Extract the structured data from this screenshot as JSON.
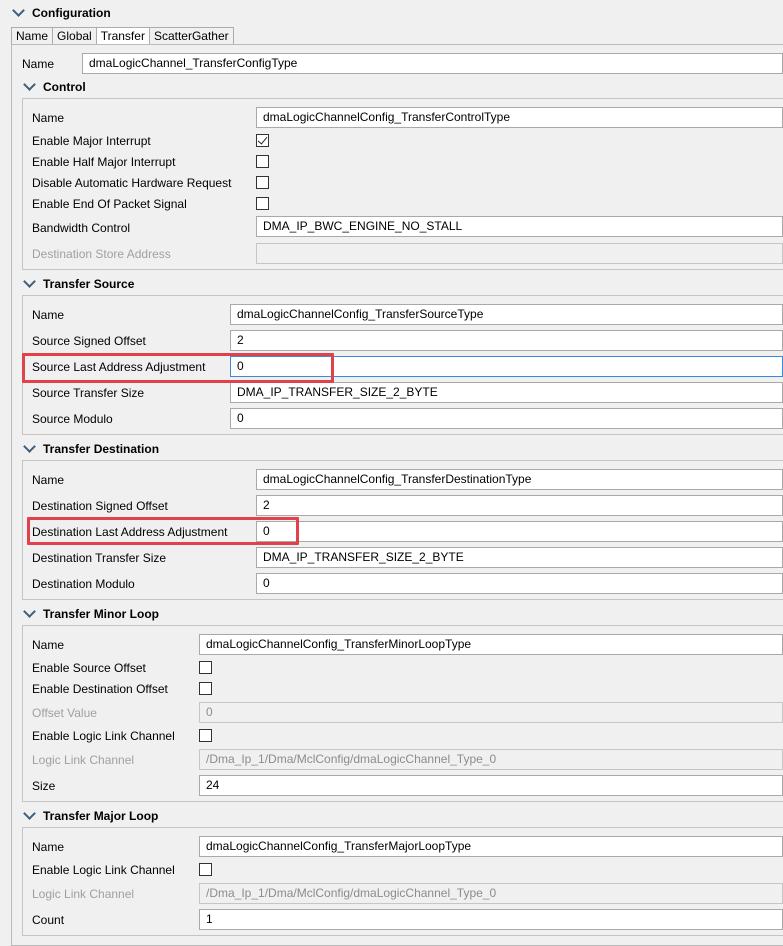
{
  "header": {
    "title": "Configuration"
  },
  "tabs": [
    "Name",
    "Global",
    "Transfer",
    "ScatterGather"
  ],
  "main": {
    "name_label": "Name",
    "name_value": "dmaLogicChannel_TransferConfigType"
  },
  "control": {
    "title": "Control",
    "name_label": "Name",
    "name_value": "dmaLogicChannelConfig_TransferControlType",
    "major_interrupt_label": "Enable Major Interrupt",
    "major_interrupt_checked": true,
    "half_major_interrupt_label": "Enable Half Major Interrupt",
    "half_major_interrupt_checked": false,
    "disable_hw_request_label": "Disable Automatic Hardware Request",
    "disable_hw_request_checked": false,
    "end_of_packet_label": "Enable End Of Packet Signal",
    "end_of_packet_checked": false,
    "bandwidth_label": "Bandwidth Control",
    "bandwidth_value": "DMA_IP_BWC_ENGINE_NO_STALL",
    "dest_store_label": "Destination Store Address",
    "dest_store_value": ""
  },
  "source": {
    "title": "Transfer Source",
    "name_label": "Name",
    "name_value": "dmaLogicChannelConfig_TransferSourceType",
    "signed_offset_label": "Source Signed Offset",
    "signed_offset_value": "2",
    "last_addr_label": "Source Last Address Adjustment",
    "last_addr_value": "0",
    "transfer_size_label": "Source Transfer Size",
    "transfer_size_value": "DMA_IP_TRANSFER_SIZE_2_BYTE",
    "modulo_label": "Source Modulo",
    "modulo_value": "0"
  },
  "destination": {
    "title": "Transfer Destination",
    "name_label": "Name",
    "name_value": "dmaLogicChannelConfig_TransferDestinationType",
    "signed_offset_label": "Destination Signed Offset",
    "signed_offset_value": "2",
    "last_addr_label": "Destination Last Address Adjustment",
    "last_addr_value": "0",
    "transfer_size_label": "Destination Transfer Size",
    "transfer_size_value": "DMA_IP_TRANSFER_SIZE_2_BYTE",
    "modulo_label": "Destination Modulo",
    "modulo_value": "0"
  },
  "minor_loop": {
    "title": "Transfer Minor Loop",
    "name_label": "Name",
    "name_value": "dmaLogicChannelConfig_TransferMinorLoopType",
    "src_offset_label": "Enable Source Offset",
    "src_offset_checked": false,
    "dst_offset_label": "Enable Destination Offset",
    "dst_offset_checked": false,
    "offset_value_label": "Offset Value",
    "offset_value": "0",
    "link_enable_label": "Enable Logic Link Channel",
    "link_enable_checked": false,
    "link_channel_label": "Logic Link Channel",
    "link_channel_value": "/Dma_Ip_1/Dma/MclConfig/dmaLogicChannel_Type_0",
    "size_label": "Size",
    "size_value": "24"
  },
  "major_loop": {
    "title": "Transfer Major Loop",
    "name_label": "Name",
    "name_value": "dmaLogicChannelConfig_TransferMajorLoopType",
    "link_enable_label": "Enable Logic Link Channel",
    "link_enable_checked": false,
    "link_channel_label": "Logic Link Channel",
    "link_channel_value": "/Dma_Ip_1/Dma/MclConfig/dmaLogicChannel_Type_0",
    "count_label": "Count",
    "count_value": "1"
  },
  "colors": {
    "highlight": "#e0414a",
    "chevron": "#3d5f7c",
    "focus_border": "#3a8ad8"
  }
}
